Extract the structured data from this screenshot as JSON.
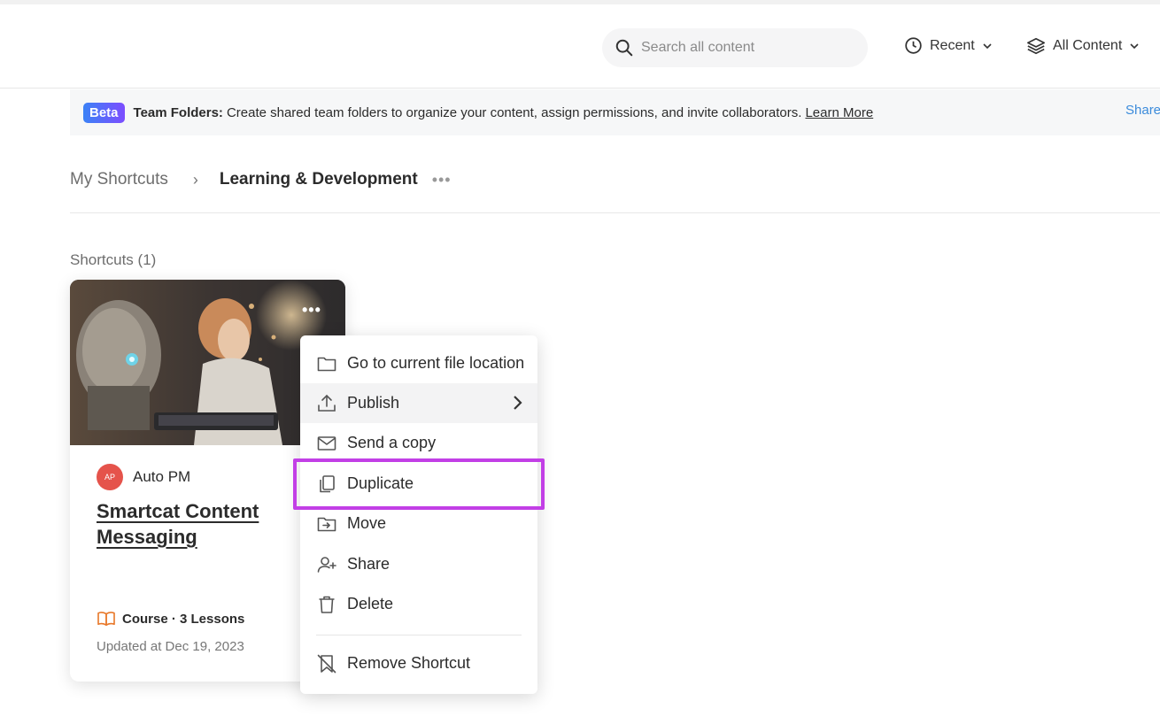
{
  "header": {
    "search_placeholder": "Search all content",
    "recent_label": "Recent",
    "all_content_label": "All Content"
  },
  "banner": {
    "badge": "Beta",
    "title": "Team Folders:",
    "text": "Create shared team folders to organize your content, assign permissions, and invite collaborators.",
    "learn_more": "Learn More",
    "share": "Share"
  },
  "breadcrumb": {
    "root": "My Shortcuts",
    "separator": "›",
    "current": "Learning & Development",
    "more": "•••"
  },
  "section": {
    "title": "Shortcuts (1)"
  },
  "card": {
    "more": "•••",
    "author_initials": "AP",
    "author_name": "Auto PM",
    "title": "Smartcat Content Messaging",
    "type_meta": "Course · 3 Lessons",
    "updated": "Updated at Dec 19, 2023"
  },
  "menu": {
    "items": [
      {
        "label": "Go to current file location",
        "icon": "folder-icon"
      },
      {
        "label": "Publish",
        "icon": "upload-icon"
      },
      {
        "label": "Send a copy",
        "icon": "mail-icon"
      },
      {
        "label": "Duplicate",
        "icon": "copy-icon"
      },
      {
        "label": "Move",
        "icon": "move-folder-icon"
      },
      {
        "label": "Share",
        "icon": "add-user-icon"
      },
      {
        "label": "Delete",
        "icon": "trash-icon"
      },
      {
        "label": "Remove Shortcut",
        "icon": "remove-bookmark-icon"
      }
    ]
  },
  "colors": {
    "highlight": "#c23fe6",
    "beta_start": "#3b82f6",
    "beta_end": "#7c4dff",
    "avatar": "#e5534b",
    "course_icon": "#e8782a",
    "link_blue": "#3b8bdb"
  }
}
